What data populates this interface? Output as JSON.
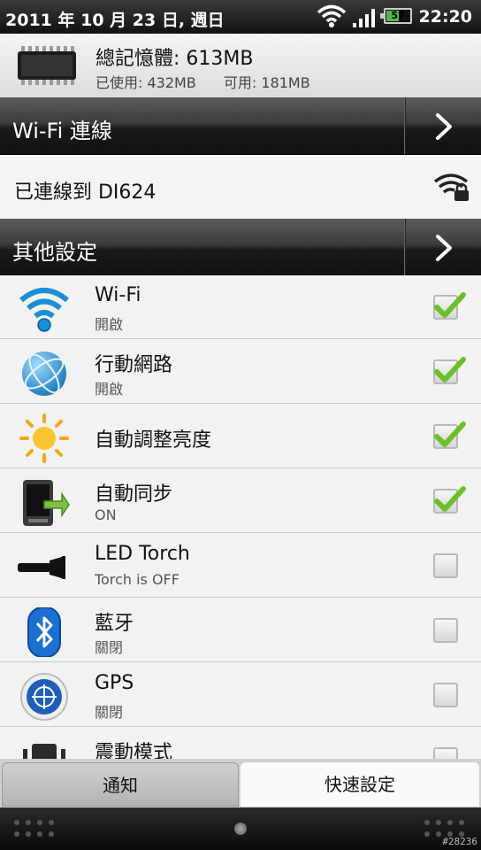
{
  "status_bar": {
    "date": "2011 年 10 月 23 日, 週日",
    "battery_level": "57",
    "time": "22:20"
  },
  "memory": {
    "title": "總記憶體: 613MB",
    "used": "已使用: 432MB",
    "available": "可用: 181MB"
  },
  "wifi_section": {
    "title": "Wi-Fi 連線",
    "status": "已連線到 DI624"
  },
  "other_section": {
    "title": "其他設定"
  },
  "settings": [
    {
      "title": "Wi-Fi",
      "subtitle": "開啟",
      "checked": true,
      "icon": "wifi-icon"
    },
    {
      "title": "行動網路",
      "subtitle": "開啟",
      "checked": true,
      "icon": "globe-icon"
    },
    {
      "title": "自動調整亮度",
      "subtitle": "",
      "checked": true,
      "icon": "sun-icon"
    },
    {
      "title": "自動同步",
      "subtitle": "ON",
      "checked": true,
      "icon": "sync-icon"
    },
    {
      "title": "LED Torch",
      "subtitle": "Torch is OFF",
      "checked": false,
      "icon": "torch-icon"
    },
    {
      "title": "藍牙",
      "subtitle": "關閉",
      "checked": false,
      "icon": "bluetooth-icon"
    },
    {
      "title": "GPS",
      "subtitle": "關閉",
      "checked": false,
      "icon": "gps-icon"
    },
    {
      "title": "震動模式",
      "subtitle": "",
      "checked": false,
      "icon": "vibrate-icon"
    }
  ],
  "tabs": {
    "notifications": "通知",
    "quick_settings": "快速設定"
  },
  "watermark": "#28236",
  "colors": {
    "check_green": "#6cbf2a",
    "battery_green": "#55b84a",
    "section_bar": "#1a1a1a"
  }
}
